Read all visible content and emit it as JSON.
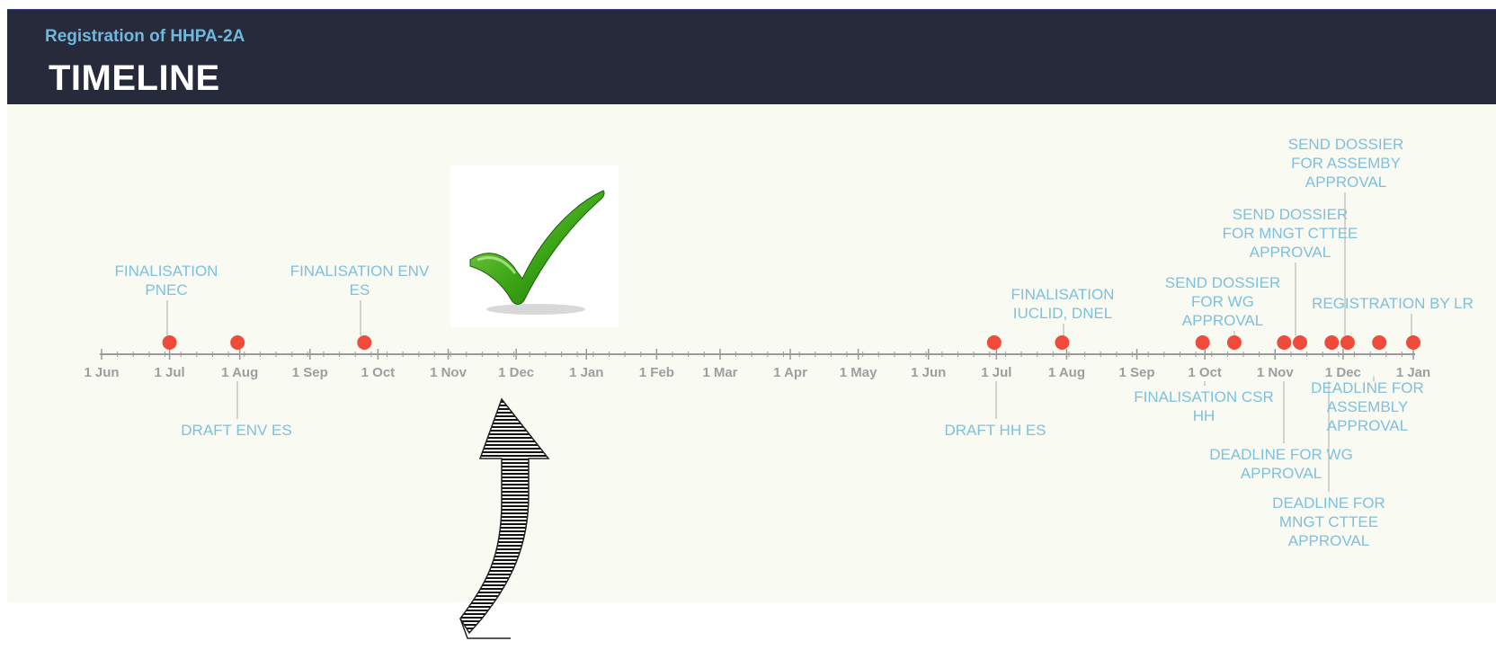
{
  "header": {
    "subtitle": "Registration of HHPA-2A",
    "title": "TIMELINE"
  },
  "colors": {
    "header_bg": "#272a3b",
    "subtitle": "#6fb7dc",
    "label": "#7ec0dd",
    "milestone": "#f04a3a",
    "axis": "#9a9a9a",
    "background": "#f9faf2",
    "check_green": "#3aa514"
  },
  "axis": {
    "start": "2016-06-01",
    "end": "2018-01-01",
    "tick_labels": [
      "1 Jun",
      "1 Jul",
      "1 Aug",
      "1 Sep",
      "1 Oct",
      "1 Nov",
      "1 Dec",
      "1 Jan",
      "1 Feb",
      "1 Mar",
      "1 Apr",
      "1 May",
      "1 Jun",
      "1 Jul",
      "1 Aug",
      "1 Sep",
      "1 Oct",
      "1 Nov",
      "1 Dec",
      "1 Jan"
    ]
  },
  "milestones": [
    {
      "label": "FINALISATION\nPNEC",
      "date": "2016-07-01",
      "side": "above"
    },
    {
      "label": "DRAFT ENV ES",
      "date": "2016-07-31",
      "side": "below"
    },
    {
      "label": "FINALISATION ENV\nES",
      "date": "2016-09-25",
      "side": "above"
    },
    {
      "label": "DRAFT HH ES",
      "date": "2017-06-30",
      "side": "below"
    },
    {
      "label": "FINALISATION\nIUCLID, DNEL",
      "date": "2017-07-30",
      "side": "above"
    },
    {
      "label": "FINALISATION CSR\nHH",
      "date": "2017-09-30",
      "side": "below"
    },
    {
      "label": "SEND DOSSIER\nFOR WG\nAPPROVAL",
      "date": "2017-10-14",
      "side": "above"
    },
    {
      "label": "DEADLINE FOR WG\nAPPROVAL",
      "date": "2017-11-05",
      "side": "below"
    },
    {
      "label": "SEND DOSSIER\nFOR MNGT CTTEE\nAPPROVAL",
      "date": "2017-11-12",
      "side": "above"
    },
    {
      "label": "DEADLINE FOR\nMNGT CTTEE\nAPPROVAL",
      "date": "2017-11-26",
      "side": "below"
    },
    {
      "label": "SEND DOSSIER\nFOR ASSEMBY\nAPPROVAL",
      "date": "2017-12-03",
      "side": "above"
    },
    {
      "label": "DEADLINE FOR\nASSEMBLY\nAPPROVAL",
      "date": "2017-12-17",
      "side": "below"
    },
    {
      "label": "REGISTRATION BY LR",
      "date": "2018-01-01",
      "side": "above"
    }
  ],
  "images": {
    "checkmark": "checkmark-icon",
    "arrow": "curved-arrow-icon"
  }
}
